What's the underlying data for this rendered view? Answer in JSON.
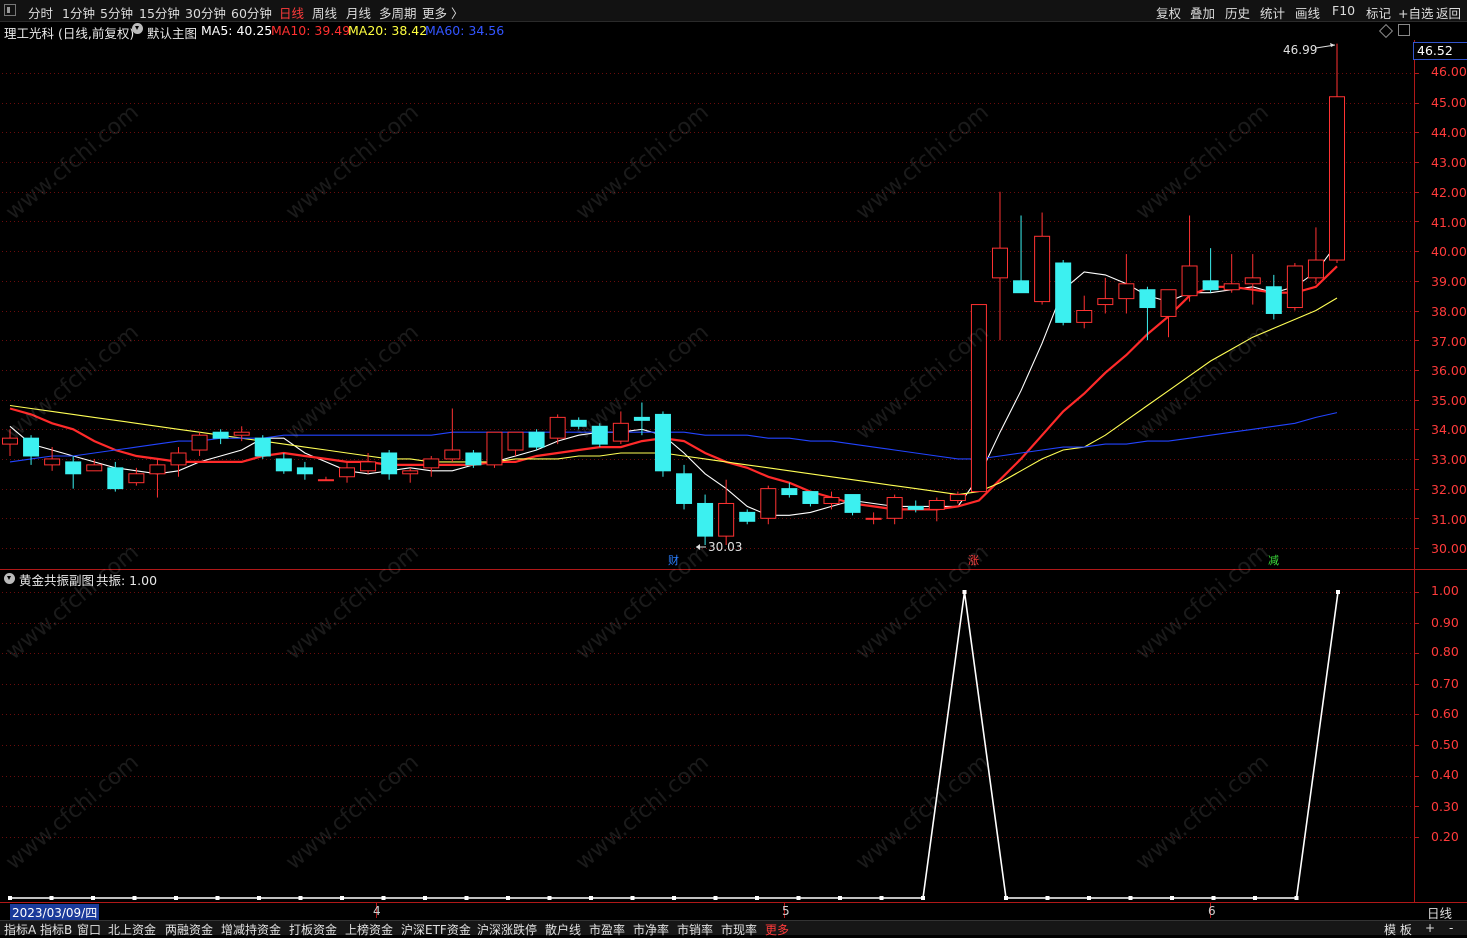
{
  "topbar": {
    "periods": [
      "分时",
      "1分钟",
      "5分钟",
      "15分钟",
      "30分钟",
      "60分钟",
      "日线",
      "周线",
      "月线",
      "多周期",
      "更多 〉"
    ],
    "active_period": "日线",
    "right_actions": [
      "复权",
      "叠加",
      "历史",
      "统计",
      "画线",
      "F10",
      "标记",
      "+自选",
      "返回"
    ]
  },
  "main_chart": {
    "stock_title": "理工光科 (日线,前复权)",
    "template_name": "默认主图",
    "ma5_label": "MA5: 40.25",
    "ma10_label": "MA10: 39.49",
    "ma20_label": "MA20: 38.42",
    "ma60_label": "MA60: 34.56",
    "current_price": "46.52",
    "high_annotation": "46.99",
    "low_annotation": "30.03",
    "y_ticks": [
      "46.00",
      "45.00",
      "44.00",
      "43.00",
      "42.00",
      "41.00",
      "40.00",
      "39.00",
      "38.00",
      "37.00",
      "36.00",
      "35.00",
      "34.00",
      "33.00",
      "32.00",
      "31.00",
      "30.00"
    ],
    "event_markers": [
      {
        "label": "财",
        "color": "#2a7fff"
      },
      {
        "label": "涨",
        "color": "#ff3b3b"
      },
      {
        "label": "减",
        "color": "#3bdc3b"
      }
    ]
  },
  "sub_chart": {
    "indicator_name": "黄金共振副图",
    "value_label": "共振: 1.00",
    "y_ticks": [
      "1.00",
      "0.90",
      "0.80",
      "0.70",
      "0.60",
      "0.50",
      "0.40",
      "0.30",
      "0.20"
    ]
  },
  "x_axis": {
    "start_date": "2023/03/09/四",
    "month_marks": [
      "4",
      "5",
      "6"
    ],
    "period_button": "日线"
  },
  "bottom_tabs": [
    "指标A",
    "指标B",
    "窗口",
    "北上资金",
    "两融资金",
    "增减持资金",
    "打板资金",
    "上榜资金",
    "沪深ETF资金",
    "沪深涨跌停",
    "散户线",
    "市盈率",
    "市净率",
    "市销率",
    "市现率",
    "更多"
  ],
  "bottom_right": [
    "模 板",
    "+",
    "-"
  ],
  "watermark": "www.cfchi.com",
  "chart_data": {
    "type": "candlestick",
    "ylim": [
      29.5,
      47.2
    ],
    "candles": [
      {
        "o": 33.5,
        "h": 34.0,
        "l": 33.1,
        "c": 33.7
      },
      {
        "o": 33.7,
        "h": 33.8,
        "l": 32.8,
        "c": 33.1
      },
      {
        "o": 32.8,
        "h": 33.4,
        "l": 32.6,
        "c": 33.0
      },
      {
        "o": 32.9,
        "h": 33.1,
        "l": 32.0,
        "c": 32.5
      },
      {
        "o": 32.6,
        "h": 33.0,
        "l": 32.6,
        "c": 32.8
      },
      {
        "o": 32.7,
        "h": 32.9,
        "l": 31.9,
        "c": 32.0
      },
      {
        "o": 32.2,
        "h": 32.7,
        "l": 32.1,
        "c": 32.5
      },
      {
        "o": 32.5,
        "h": 33.0,
        "l": 31.7,
        "c": 32.8
      },
      {
        "o": 32.8,
        "h": 33.4,
        "l": 32.4,
        "c": 33.2
      },
      {
        "o": 33.3,
        "h": 33.9,
        "l": 33.1,
        "c": 33.8
      },
      {
        "o": 33.9,
        "h": 34.0,
        "l": 33.5,
        "c": 33.7
      },
      {
        "o": 33.8,
        "h": 34.1,
        "l": 33.6,
        "c": 33.9
      },
      {
        "o": 33.7,
        "h": 33.8,
        "l": 33.0,
        "c": 33.1
      },
      {
        "o": 33.0,
        "h": 33.2,
        "l": 32.5,
        "c": 32.6
      },
      {
        "o": 32.7,
        "h": 32.9,
        "l": 32.3,
        "c": 32.5
      },
      {
        "o": 32.3,
        "h": 32.4,
        "l": 32.3,
        "c": 32.3
      },
      {
        "o": 32.4,
        "h": 32.9,
        "l": 32.2,
        "c": 32.7
      },
      {
        "o": 32.6,
        "h": 33.2,
        "l": 32.5,
        "c": 32.9
      },
      {
        "o": 33.2,
        "h": 33.3,
        "l": 32.3,
        "c": 32.5
      },
      {
        "o": 32.5,
        "h": 32.7,
        "l": 32.2,
        "c": 32.6
      },
      {
        "o": 32.7,
        "h": 33.1,
        "l": 32.4,
        "c": 33.0
      },
      {
        "o": 33.0,
        "h": 34.7,
        "l": 32.9,
        "c": 33.3
      },
      {
        "o": 33.2,
        "h": 33.3,
        "l": 32.7,
        "c": 32.8
      },
      {
        "o": 32.8,
        "h": 33.9,
        "l": 32.7,
        "c": 33.9
      },
      {
        "o": 33.3,
        "h": 33.9,
        "l": 33.1,
        "c": 33.9
      },
      {
        "o": 33.9,
        "h": 34.0,
        "l": 33.3,
        "c": 33.4
      },
      {
        "o": 33.7,
        "h": 34.5,
        "l": 33.5,
        "c": 34.4
      },
      {
        "o": 34.3,
        "h": 34.4,
        "l": 34.0,
        "c": 34.1
      },
      {
        "o": 34.1,
        "h": 34.2,
        "l": 33.4,
        "c": 33.5
      },
      {
        "o": 33.6,
        "h": 34.6,
        "l": 33.5,
        "c": 34.2
      },
      {
        "o": 34.4,
        "h": 34.9,
        "l": 33.8,
        "c": 34.3
      },
      {
        "o": 34.5,
        "h": 34.6,
        "l": 32.4,
        "c": 32.6
      },
      {
        "o": 32.5,
        "h": 32.8,
        "l": 31.3,
        "c": 31.5
      },
      {
        "o": 31.5,
        "h": 31.8,
        "l": 30.1,
        "c": 30.4
      },
      {
        "o": 30.4,
        "h": 32.3,
        "l": 30.1,
        "c": 31.5
      },
      {
        "o": 31.2,
        "h": 31.3,
        "l": 30.8,
        "c": 30.9
      },
      {
        "o": 31.0,
        "h": 32.1,
        "l": 30.8,
        "c": 32.0
      },
      {
        "o": 32.0,
        "h": 32.2,
        "l": 31.7,
        "c": 31.8
      },
      {
        "o": 31.9,
        "h": 31.9,
        "l": 31.4,
        "c": 31.5
      },
      {
        "o": 31.5,
        "h": 31.9,
        "l": 31.3,
        "c": 31.7
      },
      {
        "o": 31.8,
        "h": 31.8,
        "l": 31.1,
        "c": 31.2
      },
      {
        "o": 31.0,
        "h": 31.2,
        "l": 30.8,
        "c": 31.0
      },
      {
        "o": 31.0,
        "h": 31.8,
        "l": 30.8,
        "c": 31.7
      },
      {
        "o": 31.4,
        "h": 31.6,
        "l": 31.2,
        "c": 31.3
      },
      {
        "o": 31.3,
        "h": 31.7,
        "l": 30.9,
        "c": 31.6
      },
      {
        "o": 31.6,
        "h": 31.9,
        "l": 31.5,
        "c": 31.8
      },
      {
        "o": 31.9,
        "h": 38.2,
        "l": 31.9,
        "c": 38.2
      },
      {
        "o": 39.1,
        "h": 42.0,
        "l": 37.0,
        "c": 40.1
      },
      {
        "o": 39.0,
        "h": 41.2,
        "l": 38.7,
        "c": 38.6
      },
      {
        "o": 38.3,
        "h": 41.3,
        "l": 38.2,
        "c": 40.5
      },
      {
        "o": 39.6,
        "h": 39.7,
        "l": 37.5,
        "c": 37.6
      },
      {
        "o": 37.6,
        "h": 38.5,
        "l": 37.4,
        "c": 38.0
      },
      {
        "o": 38.2,
        "h": 39.1,
        "l": 37.9,
        "c": 38.4
      },
      {
        "o": 38.4,
        "h": 39.9,
        "l": 37.9,
        "c": 38.9
      },
      {
        "o": 38.7,
        "h": 38.8,
        "l": 37.0,
        "c": 38.1
      },
      {
        "o": 37.8,
        "h": 38.7,
        "l": 37.1,
        "c": 38.7
      },
      {
        "o": 38.5,
        "h": 41.2,
        "l": 38.3,
        "c": 39.5
      },
      {
        "o": 39.0,
        "h": 40.1,
        "l": 38.6,
        "c": 38.7
      },
      {
        "o": 38.7,
        "h": 39.9,
        "l": 38.6,
        "c": 38.9
      },
      {
        "o": 38.9,
        "h": 39.9,
        "l": 38.2,
        "c": 39.1
      },
      {
        "o": 38.8,
        "h": 39.2,
        "l": 37.7,
        "c": 37.9
      },
      {
        "o": 38.1,
        "h": 39.6,
        "l": 38.0,
        "c": 39.5
      },
      {
        "o": 39.1,
        "h": 40.8,
        "l": 38.9,
        "c": 39.7
      },
      {
        "o": 39.7,
        "h": 46.99,
        "l": 39.6,
        "c": 45.2
      }
    ],
    "ma_series": [
      {
        "name": "MA5",
        "color": "#ffffff",
        "values": [
          34.1,
          33.5,
          33.3,
          33.1,
          32.9,
          32.7,
          32.6,
          32.5,
          32.6,
          32.9,
          33.1,
          33.3,
          33.7,
          33.7,
          33.2,
          32.9,
          32.6,
          32.5,
          32.6,
          32.7,
          32.6,
          32.6,
          32.8,
          32.9,
          33.1,
          33.3,
          33.6,
          33.8,
          33.9,
          33.9,
          34.0,
          33.8,
          33.2,
          32.5,
          32.0,
          31.4,
          31.1,
          31.1,
          31.2,
          31.4,
          31.6,
          31.5,
          31.4,
          31.4,
          31.4,
          31.4,
          32.4,
          33.9,
          35.3,
          36.9,
          38.7,
          39.3,
          39.2,
          38.9,
          38.5,
          38.3,
          38.6,
          38.6,
          38.7,
          38.8,
          38.6,
          38.8,
          39.3,
          40.25
        ]
      },
      {
        "name": "MA10",
        "color": "#ff2a2a",
        "values": [
          34.7,
          34.5,
          34.2,
          34.0,
          33.6,
          33.3,
          33.1,
          33.0,
          32.9,
          32.9,
          32.9,
          32.9,
          33.1,
          33.2,
          33.1,
          33.0,
          32.9,
          32.9,
          32.8,
          32.8,
          32.8,
          32.8,
          32.8,
          32.9,
          32.9,
          33.1,
          33.2,
          33.3,
          33.4,
          33.4,
          33.6,
          33.7,
          33.6,
          33.2,
          32.9,
          32.7,
          32.4,
          32.2,
          31.9,
          31.7,
          31.5,
          31.4,
          31.3,
          31.3,
          31.3,
          31.4,
          31.6,
          32.3,
          33.0,
          33.8,
          34.6,
          35.2,
          35.9,
          36.5,
          37.2,
          37.8,
          38.5,
          38.8,
          38.8,
          38.7,
          38.6,
          38.6,
          38.8,
          39.49
        ]
      },
      {
        "name": "MA20",
        "color": "#ffff55",
        "values": [
          34.8,
          34.7,
          34.6,
          34.5,
          34.4,
          34.3,
          34.2,
          34.1,
          34.0,
          33.9,
          33.8,
          33.7,
          33.6,
          33.5,
          33.4,
          33.3,
          33.2,
          33.1,
          33.0,
          33.0,
          32.9,
          32.9,
          32.9,
          32.9,
          33.0,
          33.0,
          33.0,
          33.1,
          33.1,
          33.2,
          33.2,
          33.2,
          33.1,
          33.0,
          32.9,
          32.8,
          32.7,
          32.6,
          32.5,
          32.4,
          32.3,
          32.2,
          32.1,
          32.0,
          31.9,
          31.8,
          31.9,
          32.2,
          32.6,
          33.0,
          33.3,
          33.4,
          33.8,
          34.3,
          34.8,
          35.3,
          35.8,
          36.3,
          36.7,
          37.1,
          37.4,
          37.7,
          38.0,
          38.42
        ]
      },
      {
        "name": "MA60",
        "color": "#2244ff",
        "values": [
          32.9,
          33.0,
          33.1,
          33.1,
          33.2,
          33.3,
          33.4,
          33.5,
          33.6,
          33.6,
          33.7,
          33.7,
          33.7,
          33.8,
          33.8,
          33.8,
          33.8,
          33.8,
          33.8,
          33.8,
          33.8,
          33.9,
          33.9,
          33.9,
          33.9,
          33.9,
          33.9,
          33.9,
          33.9,
          33.9,
          33.9,
          33.9,
          33.9,
          33.8,
          33.8,
          33.8,
          33.7,
          33.7,
          33.6,
          33.6,
          33.5,
          33.4,
          33.3,
          33.2,
          33.1,
          33.0,
          33.0,
          33.1,
          33.2,
          33.3,
          33.4,
          33.4,
          33.5,
          33.5,
          33.6,
          33.6,
          33.7,
          33.8,
          33.9,
          34.0,
          34.1,
          34.2,
          34.4,
          34.56
        ]
      }
    ],
    "resonance": {
      "name": "共振",
      "values": [
        0,
        0,
        0,
        0,
        0,
        0,
        0,
        0,
        0,
        0,
        0,
        0,
        0,
        0,
        0,
        0,
        0,
        0,
        0,
        0,
        0,
        0,
        0,
        1,
        0,
        0,
        0,
        0,
        0,
        0,
        0,
        0,
        1
      ]
    }
  }
}
